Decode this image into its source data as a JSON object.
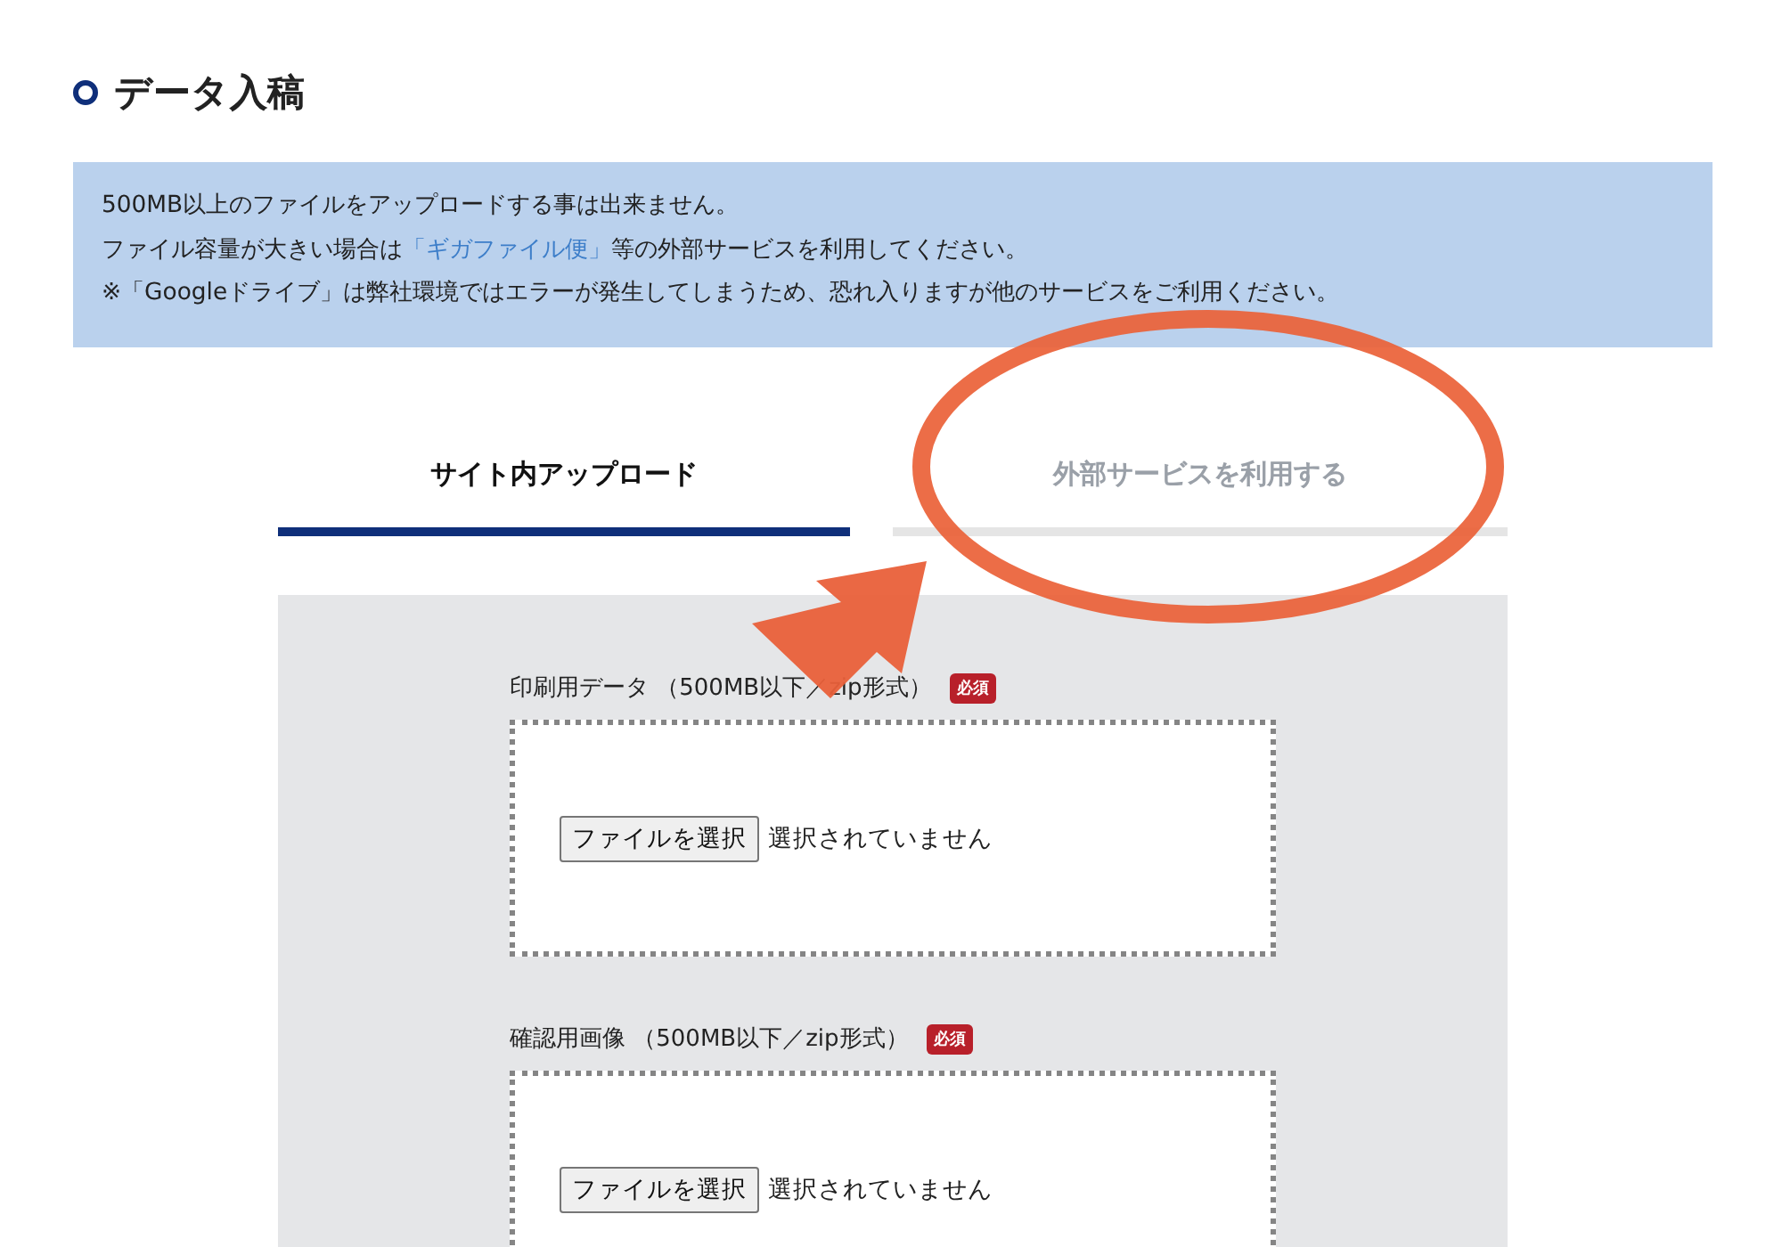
{
  "heading": "データ入稿",
  "notice": {
    "lines": [
      [
        {
          "kind": "text",
          "text": "500MB以上のファイルをアップロードする事は出来ません。"
        }
      ],
      [
        {
          "kind": "text",
          "text": "ファイル容量が大きい場合は"
        },
        {
          "kind": "link",
          "text": "「ギガファイル便」"
        },
        {
          "kind": "text",
          "text": "等の外部サービスを利用してください。"
        }
      ],
      [
        {
          "kind": "text",
          "text": "※「Googleドライブ」は弊社環境ではエラーが発生してしまうため、恐れ入りますが他のサービスをご利用ください。"
        }
      ]
    ]
  },
  "tabs": [
    {
      "label": "サイト内アップロード",
      "selected": true
    },
    {
      "label": "外部サービスを利用する",
      "selected": false
    }
  ],
  "fields": [
    {
      "label": "印刷用データ （500MB以下／zip形式）",
      "badge": "必須",
      "button": "ファイルを選択",
      "status": "選択されていません"
    },
    {
      "label": "確認用画像 （500MB以下／zip形式）",
      "badge": "必須",
      "button": "ファイルを選択",
      "status": "選択されていません"
    }
  ]
}
